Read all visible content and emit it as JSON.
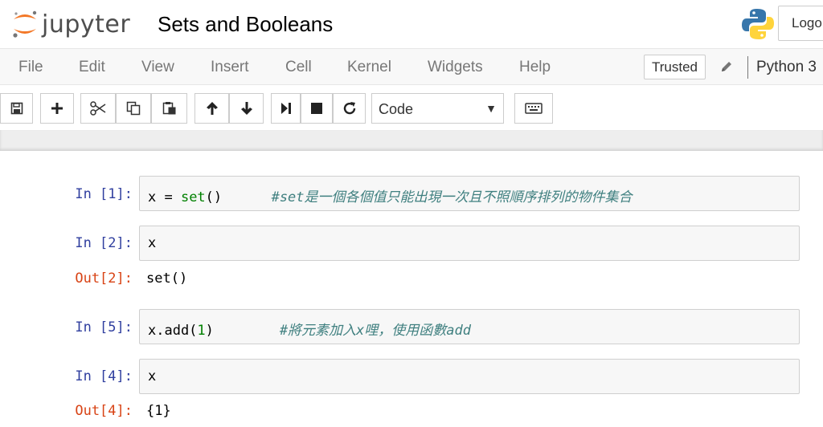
{
  "header": {
    "logo_text": "jupyter",
    "notebook_title": "Sets and Booleans",
    "logout_label": "Logo"
  },
  "menubar": {
    "items": [
      "File",
      "Edit",
      "View",
      "Insert",
      "Cell",
      "Kernel",
      "Widgets",
      "Help"
    ],
    "trusted_label": "Trusted",
    "kernel_name": "Python 3"
  },
  "toolbar": {
    "cell_type": "Code",
    "buttons": [
      "save-icon",
      "plus-icon",
      "scissors-icon",
      "copy-icon",
      "paste-icon",
      "arrow-up-icon",
      "arrow-down-icon",
      "step-forward-icon",
      "stop-icon",
      "restart-icon",
      "keyboard-icon"
    ]
  },
  "cells": [
    {
      "in_prompt": "In [1]:",
      "code_a": "x = ",
      "code_kw": "set",
      "code_b": "()",
      "comment": "#set是一個各個值只能出現一次且不照順序排列的物件集合"
    },
    {
      "in_prompt": "In [2]:",
      "code": "x",
      "out_prompt": "Out[2]:",
      "output": "set()"
    },
    {
      "in_prompt": "In [5]:",
      "code_a": "x.add(",
      "code_num": "1",
      "code_b": ")",
      "comment": "#將元素加入x哩，使用函數add"
    },
    {
      "in_prompt": "In [4]:",
      "code": "x",
      "out_prompt": "Out[4]:",
      "output": "{1}"
    }
  ],
  "colors": {
    "in_prompt": "#303f9f",
    "out_prompt": "#d84315",
    "keyword": "#008000",
    "comment": "#408080",
    "logo_orange": "#f37726"
  }
}
